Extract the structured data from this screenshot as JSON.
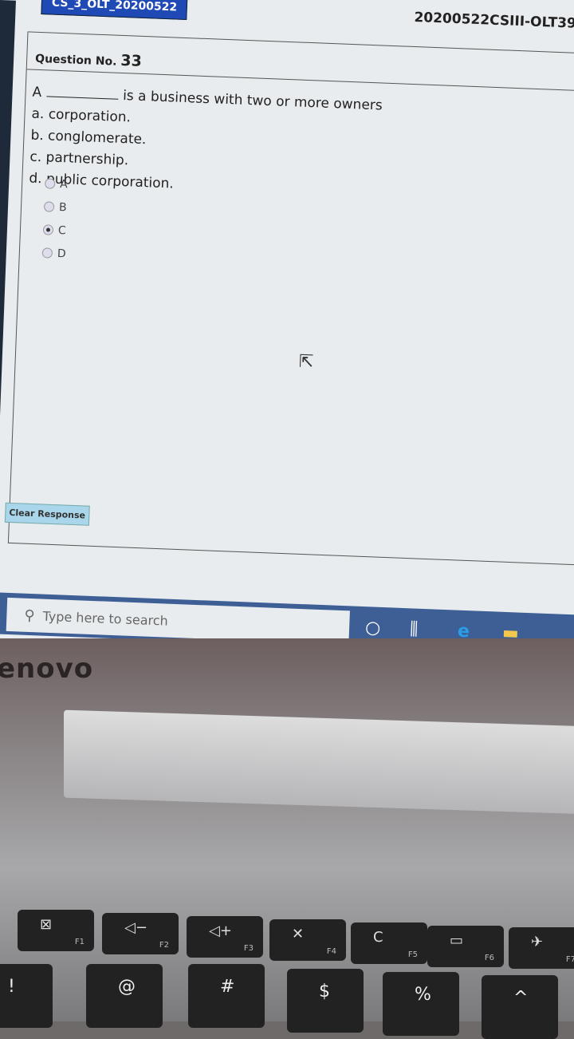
{
  "exam": {
    "tab_label": "CS_3_OLT_20200522",
    "code": "20200522CSIII-OLT39"
  },
  "question": {
    "label": "Question No.",
    "number": "33",
    "stem_before": "A",
    "stem_after": "is a business with two or more owners",
    "choices": [
      "a. corporation.",
      "b. conglomerate.",
      "c. partnership.",
      "d. public corporation."
    ]
  },
  "options": [
    {
      "label": "A",
      "selected": false
    },
    {
      "label": "B",
      "selected": false
    },
    {
      "label": "C",
      "selected": true
    },
    {
      "label": "D",
      "selected": false
    }
  ],
  "clear_button": "Clear Response",
  "taskbar": {
    "search_placeholder": "Type here to search"
  },
  "laptop": {
    "logo": "enovo"
  },
  "keyboard": {
    "fkeys": [
      {
        "sym": "⊠",
        "fn": "F1"
      },
      {
        "sym": "◁−",
        "fn": "F2"
      },
      {
        "sym": "◁+",
        "fn": "F3"
      },
      {
        "sym": "✕",
        "fn": "F4"
      },
      {
        "sym": "C",
        "fn": "F5"
      },
      {
        "sym": "▭",
        "fn": "F6"
      },
      {
        "sym": "✈",
        "fn": "F7"
      }
    ],
    "numkeys": [
      "!",
      "@",
      "#",
      "$",
      "%",
      "^"
    ]
  }
}
